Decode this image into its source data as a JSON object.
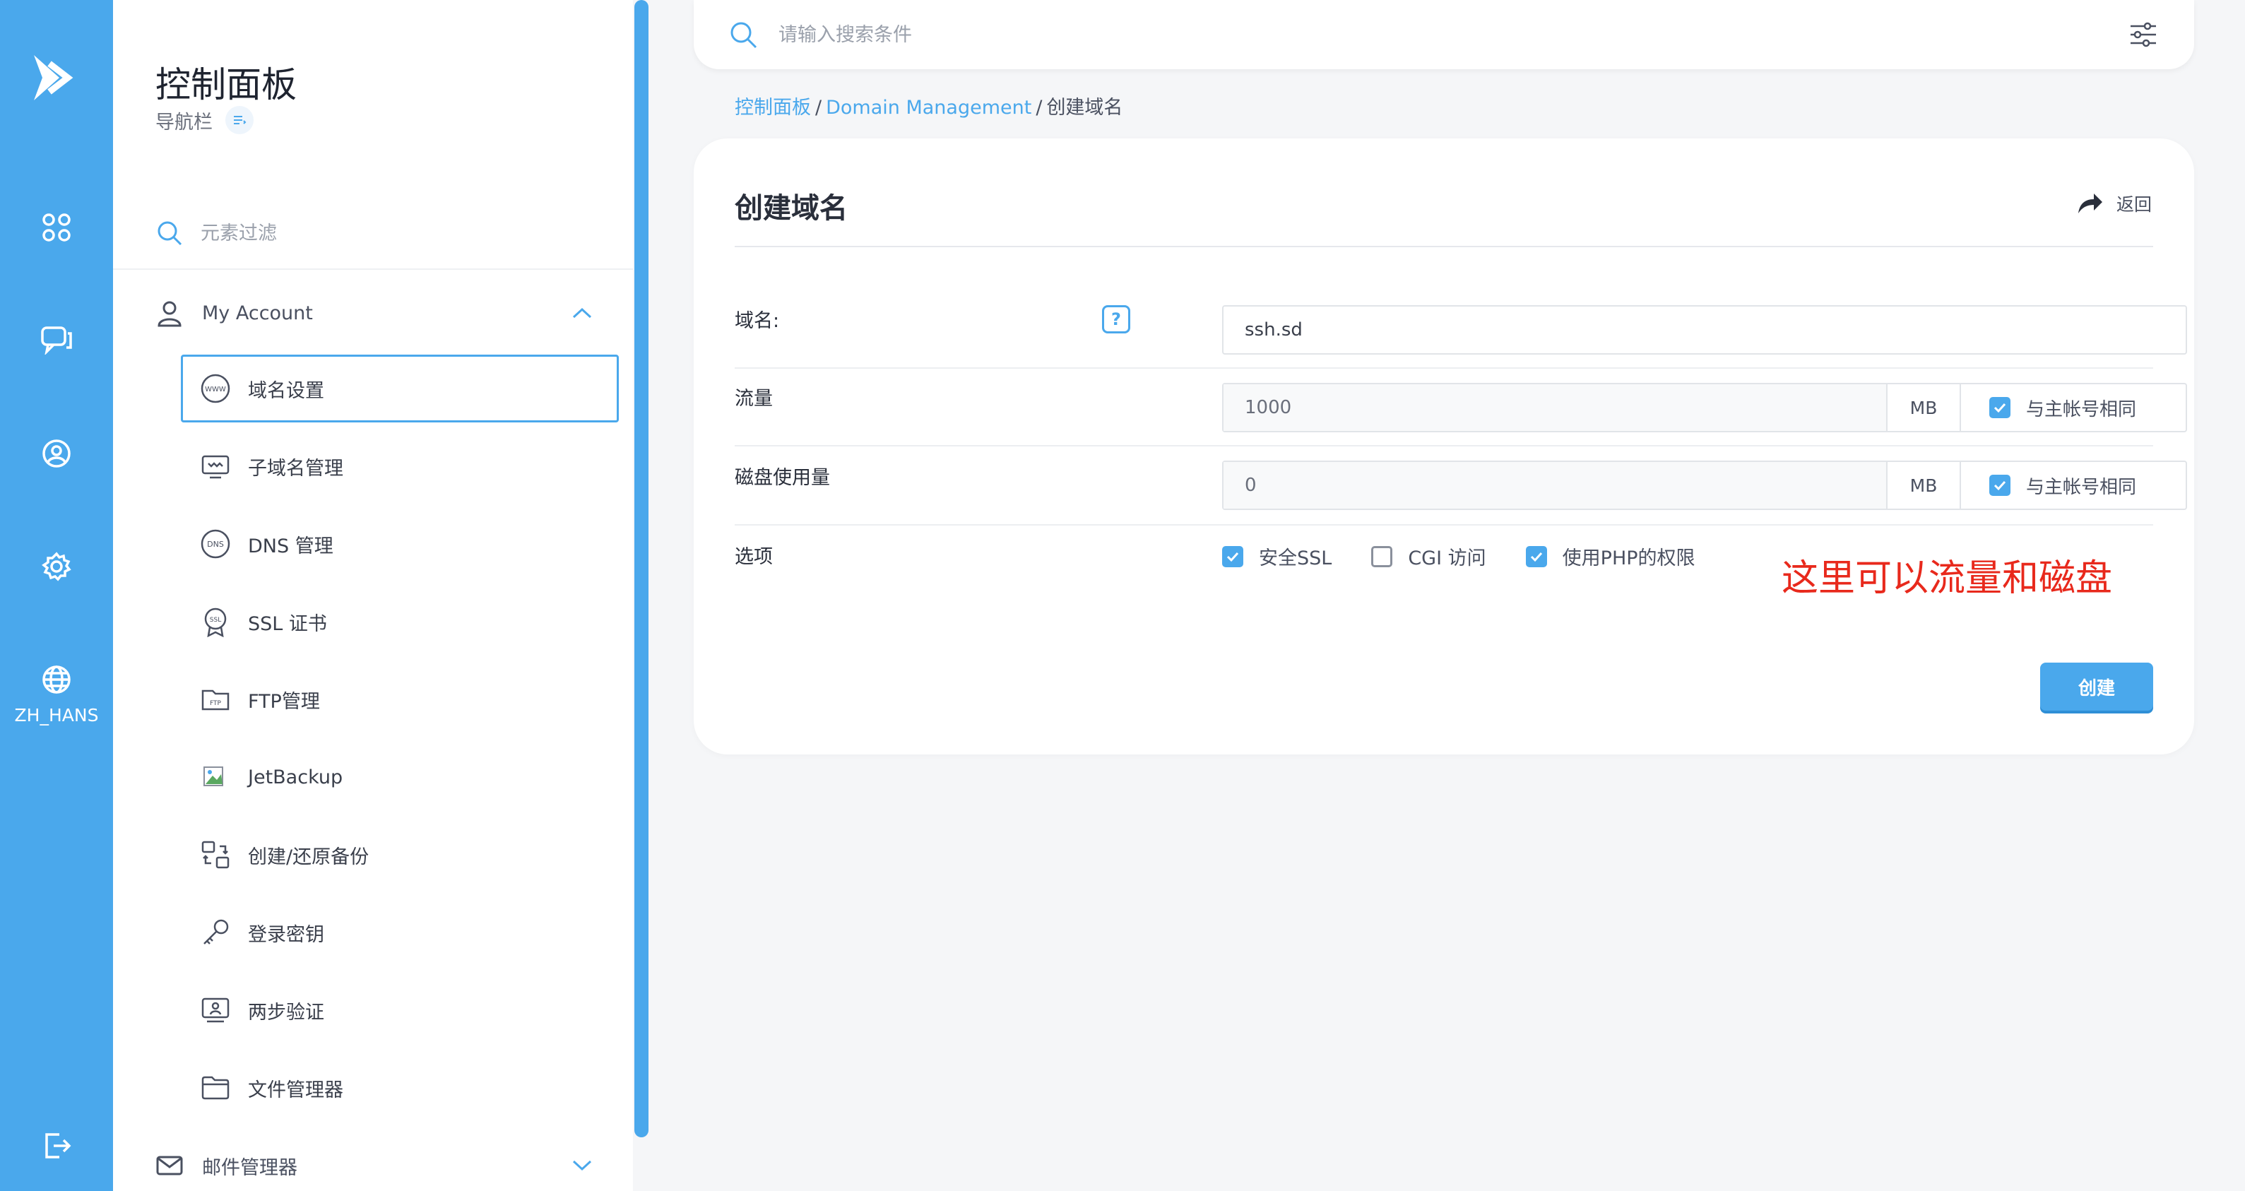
{
  "rail": {
    "language_label": "ZH_HANS"
  },
  "nav": {
    "title": "控制面板",
    "subtitle": "导航栏",
    "filter_placeholder": "元素过滤",
    "account_label": "My Account",
    "items": [
      {
        "label": "域名设置",
        "icon": "www-icon",
        "active": true
      },
      {
        "label": "子域名管理",
        "icon": "subdomain-icon"
      },
      {
        "label": "DNS 管理",
        "icon": "dns-icon"
      },
      {
        "label": "SSL 证书",
        "icon": "ssl-icon"
      },
      {
        "label": "FTP管理",
        "icon": "ftp-folder-icon"
      },
      {
        "label": "JetBackup",
        "icon": "broken-image-icon"
      },
      {
        "label": "创建/还原备份",
        "icon": "backup-icon"
      },
      {
        "label": "登录密钥",
        "icon": "key-icon"
      },
      {
        "label": "两步验证",
        "icon": "two-step-icon"
      },
      {
        "label": "文件管理器",
        "icon": "folder-icon"
      }
    ],
    "mail_label": "邮件管理器"
  },
  "search": {
    "placeholder": "请输入搜索条件"
  },
  "breadcrumb": {
    "home": "控制面板",
    "section": "Domain Management",
    "current": "创建域名",
    "separator": "/"
  },
  "form": {
    "title": "创建域名",
    "back_label": "返回",
    "domain": {
      "label": "域名:",
      "value": "ssh.sd"
    },
    "traffic": {
      "label": "流量",
      "value": "1000",
      "unit": "MB",
      "same_label": "与主帐号相同",
      "same_checked": true
    },
    "disk": {
      "label": "磁盘使用量",
      "value": "0",
      "unit": "MB",
      "same_label": "与主帐号相同",
      "same_checked": true
    },
    "options": {
      "label": "选项",
      "items": [
        {
          "label": "安全SSL",
          "checked": true
        },
        {
          "label": "CGI 访问",
          "checked": false
        },
        {
          "label": "使用PHP的权限",
          "checked": true
        }
      ]
    },
    "annotation": "这里可以流量和磁盘",
    "submit_label": "创建"
  },
  "colors": {
    "accent": "#4aa8ec",
    "annotation": "#e8291c"
  }
}
